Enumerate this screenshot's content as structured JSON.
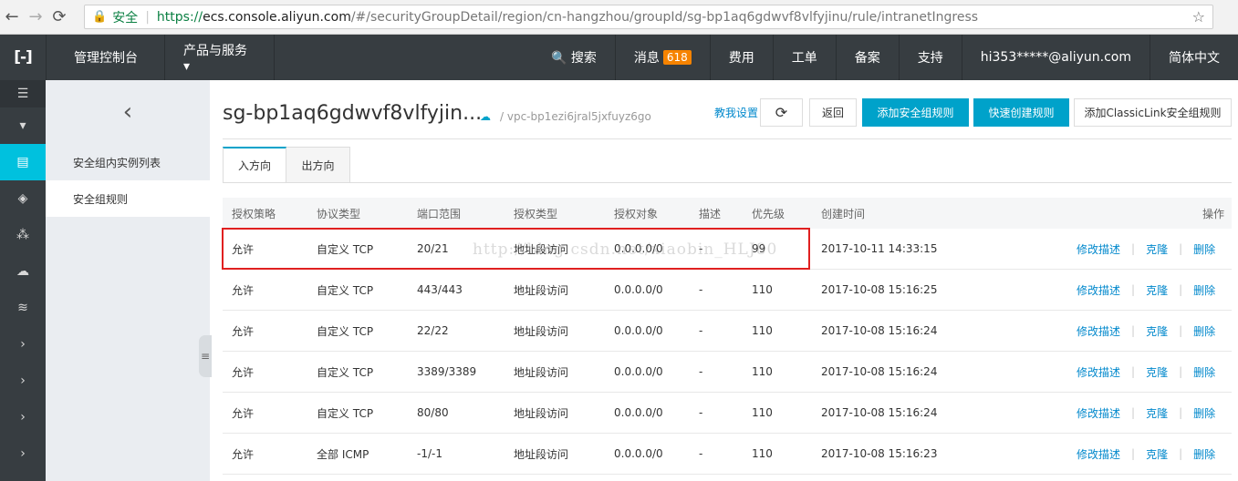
{
  "browser": {
    "back": "←",
    "forward": "→",
    "reload": "⟳",
    "lock": "🔒",
    "secure_label": "安全",
    "url_scheme": "https://",
    "url_host": "ecs.console.aliyun.com",
    "url_path": "/#/securityGroupDetail/region/cn-hangzhou/groupId/sg-bp1aq6gdwvf8vlfyjinu/rule/intranetIngress",
    "star": "☆"
  },
  "topnav": {
    "logo": "[-]",
    "console": "管理控制台",
    "products": "产品与服务 ▾",
    "search": "🔍 搜索",
    "messages": "消息",
    "messages_count": "618",
    "billing": "费用",
    "tickets": "工单",
    "icp": "备案",
    "support": "支持",
    "user": "hi353*****@aliyun.com",
    "language": "简体中文"
  },
  "iconbar": {
    "items": [
      "☰",
      "▾",
      "▤",
      "◈",
      "⁂",
      "☁",
      "≋",
      "›",
      "›",
      "›",
      "›"
    ]
  },
  "sidebar": {
    "back": "‹",
    "items": [
      "安全组内实例列表",
      "安全组规则"
    ],
    "handle": "≡"
  },
  "main": {
    "title": "sg-bp1aq6gdwvf8vlfyjin...",
    "vpc": "/ vpc-bp1ezi6jral5jxfuyz6go",
    "help_link": "教我设置",
    "refresh": "⟳",
    "back": "返回",
    "add_rule": "添加安全组规则",
    "quick_rule": "快速创建规则",
    "classic_link": "添加ClassicLink安全组规则",
    "tabs": [
      "入方向",
      "出方向"
    ]
  },
  "table": {
    "headers": [
      "授权策略",
      "协议类型",
      "端口范围",
      "授权类型",
      "授权对象",
      "描述",
      "优先级",
      "创建时间",
      "操作"
    ],
    "rows": [
      {
        "policy": "允许",
        "protocol": "自定义 TCP",
        "port": "20/21",
        "auth_type": "地址段访问",
        "auth_obj": "0.0.0.0/0",
        "desc": "-",
        "priority": "99",
        "created": "2017-10-11 14:33:15"
      },
      {
        "policy": "允许",
        "protocol": "自定义 TCP",
        "port": "443/443",
        "auth_type": "地址段访问",
        "auth_obj": "0.0.0.0/0",
        "desc": "-",
        "priority": "110",
        "created": "2017-10-08 15:16:25"
      },
      {
        "policy": "允许",
        "protocol": "自定义 TCP",
        "port": "22/22",
        "auth_type": "地址段访问",
        "auth_obj": "0.0.0.0/0",
        "desc": "-",
        "priority": "110",
        "created": "2017-10-08 15:16:24"
      },
      {
        "policy": "允许",
        "protocol": "自定义 TCP",
        "port": "3389/3389",
        "auth_type": "地址段访问",
        "auth_obj": "0.0.0.0/0",
        "desc": "-",
        "priority": "110",
        "created": "2017-10-08 15:16:24"
      },
      {
        "policy": "允许",
        "protocol": "自定义 TCP",
        "port": "80/80",
        "auth_type": "地址段访问",
        "auth_obj": "0.0.0.0/0",
        "desc": "-",
        "priority": "110",
        "created": "2017-10-08 15:16:24"
      },
      {
        "policy": "允许",
        "protocol": "全部 ICMP",
        "port": "-1/-1",
        "auth_type": "地址段访问",
        "auth_obj": "0.0.0.0/0",
        "desc": "-",
        "priority": "110",
        "created": "2017-10-08 15:16:23"
      }
    ],
    "actions": [
      "修改描述",
      "克隆",
      "删除"
    ],
    "action_sep": "|"
  },
  "watermark": "http://blog.csdn.net/xiaobin_HLJ80"
}
